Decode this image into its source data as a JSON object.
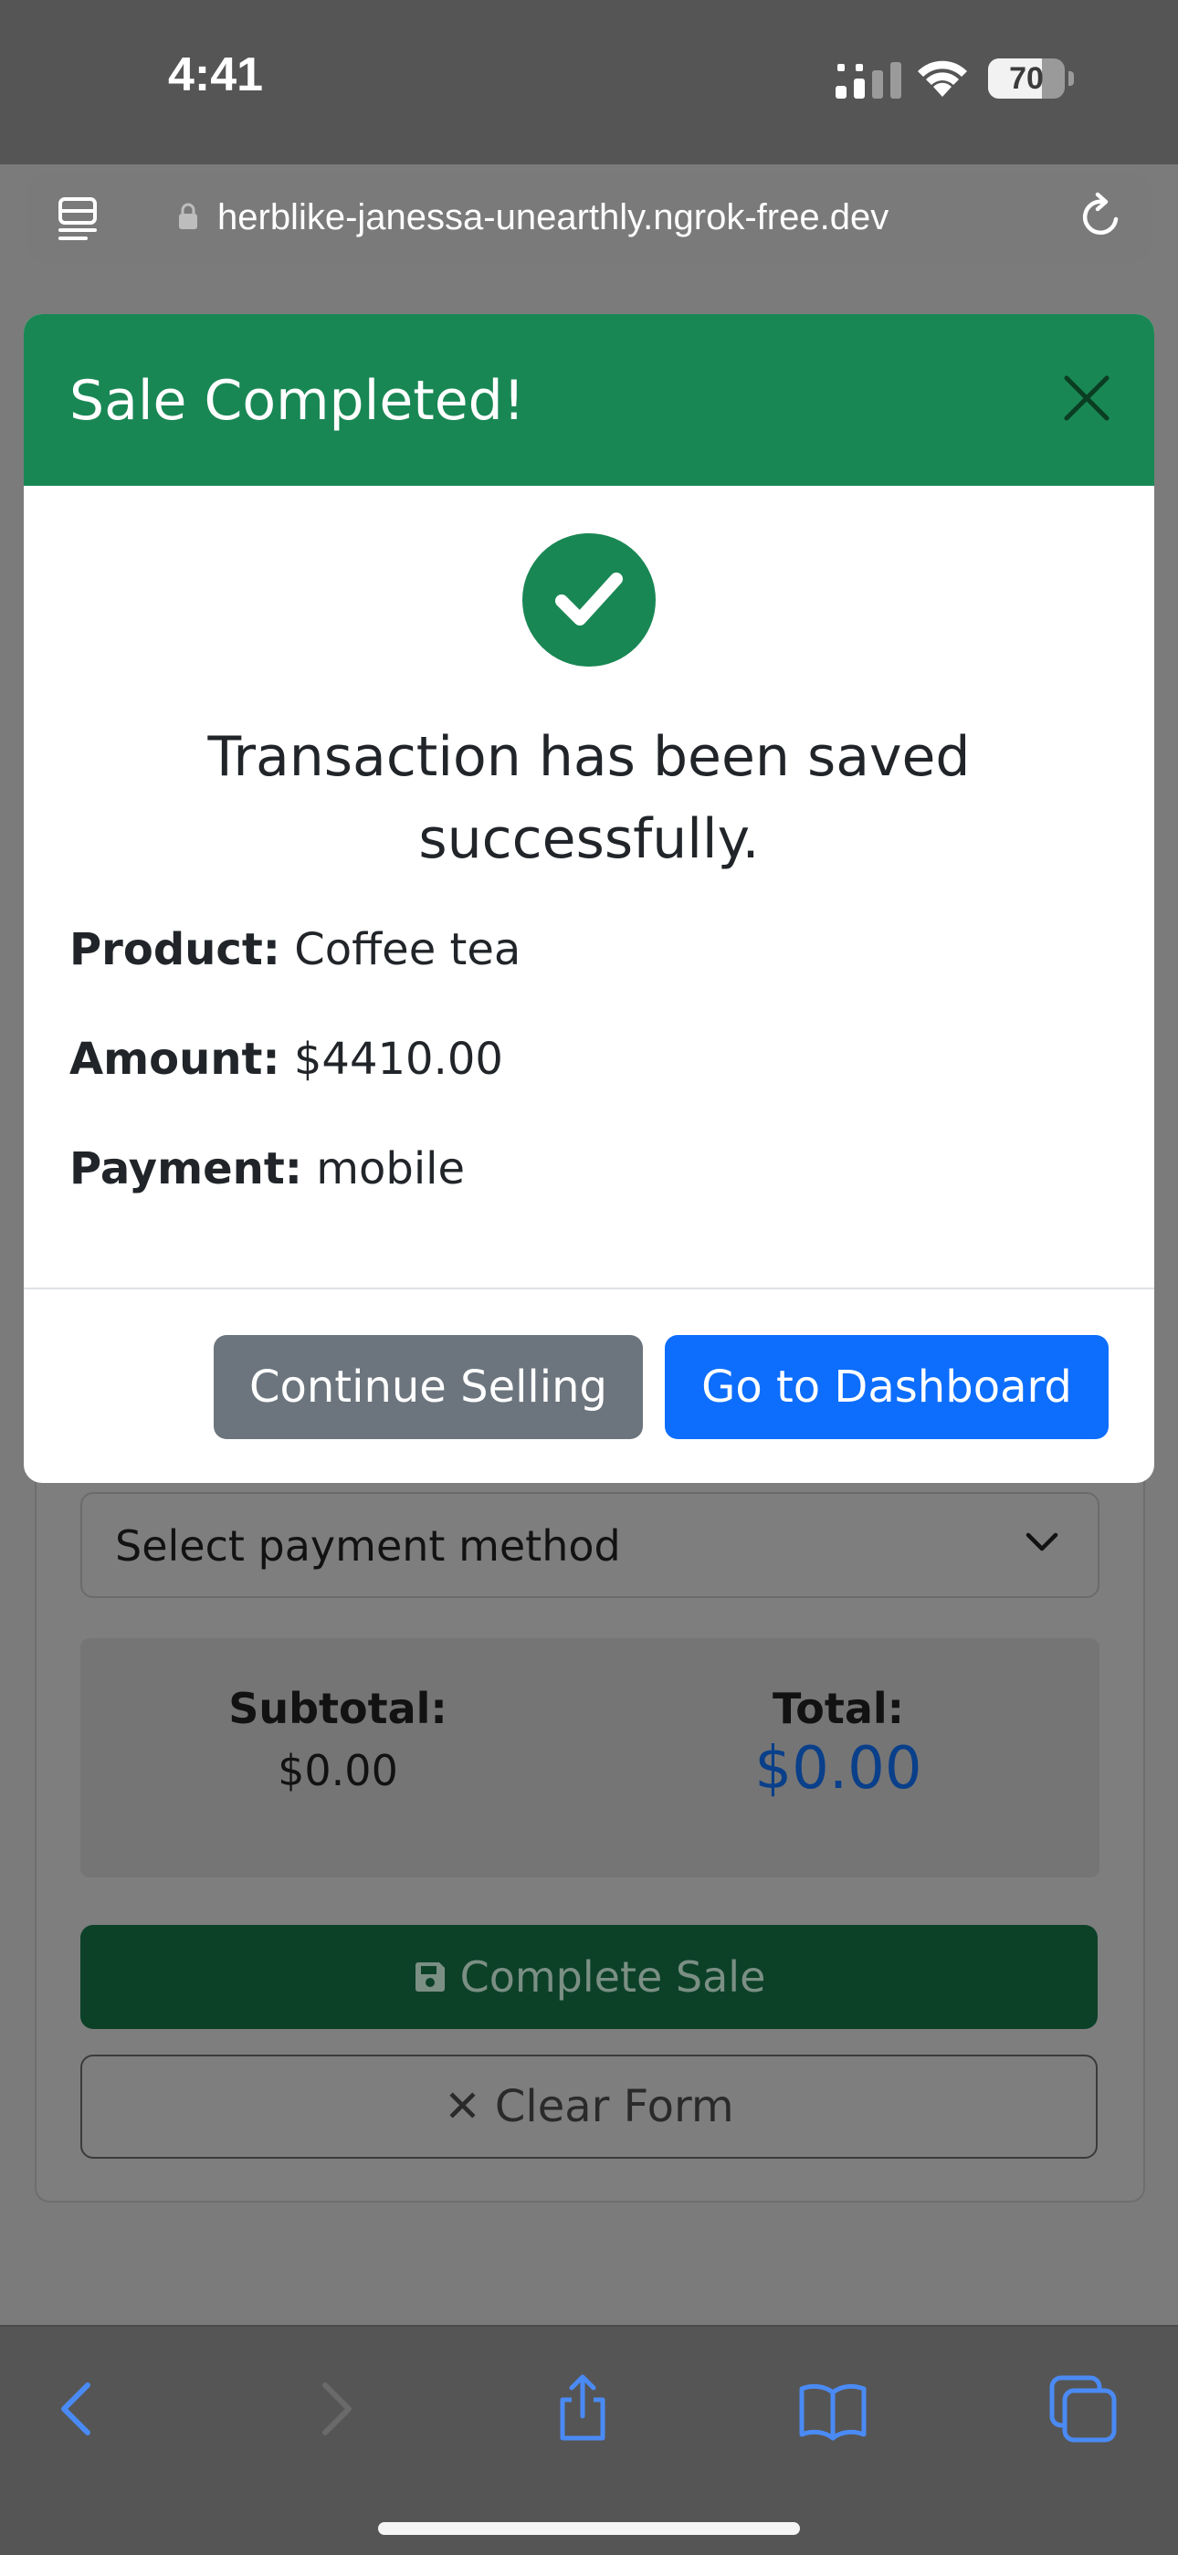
{
  "status": {
    "time": "4:41",
    "battery": "70",
    "battery_level": 0.7
  },
  "browser": {
    "url": "herblike-janessa-unearthly.ngrok-free.dev"
  },
  "modal": {
    "title": "Sale Completed!",
    "message": "Transaction has been saved successfully.",
    "details": [
      {
        "label": "Product:",
        "value": "Coffee tea"
      },
      {
        "label": "Amount:",
        "value": "$4410.00"
      },
      {
        "label": "Payment:",
        "value": "mobile"
      }
    ],
    "continue_label": "Continue Selling",
    "dashboard_label": "Go to Dashboard"
  },
  "form": {
    "payment_placeholder": "Select payment method",
    "subtotal_label": "Subtotal:",
    "subtotal_value": "$0.00",
    "total_label": "Total:",
    "total_value": "$0.00",
    "complete_label": "Complete Sale",
    "clear_label": "✕ Clear Form"
  },
  "colors": {
    "success": "#198754",
    "primary": "#0d6efd",
    "secondary": "#6c757d",
    "ios_accent": "#4a8af4"
  }
}
